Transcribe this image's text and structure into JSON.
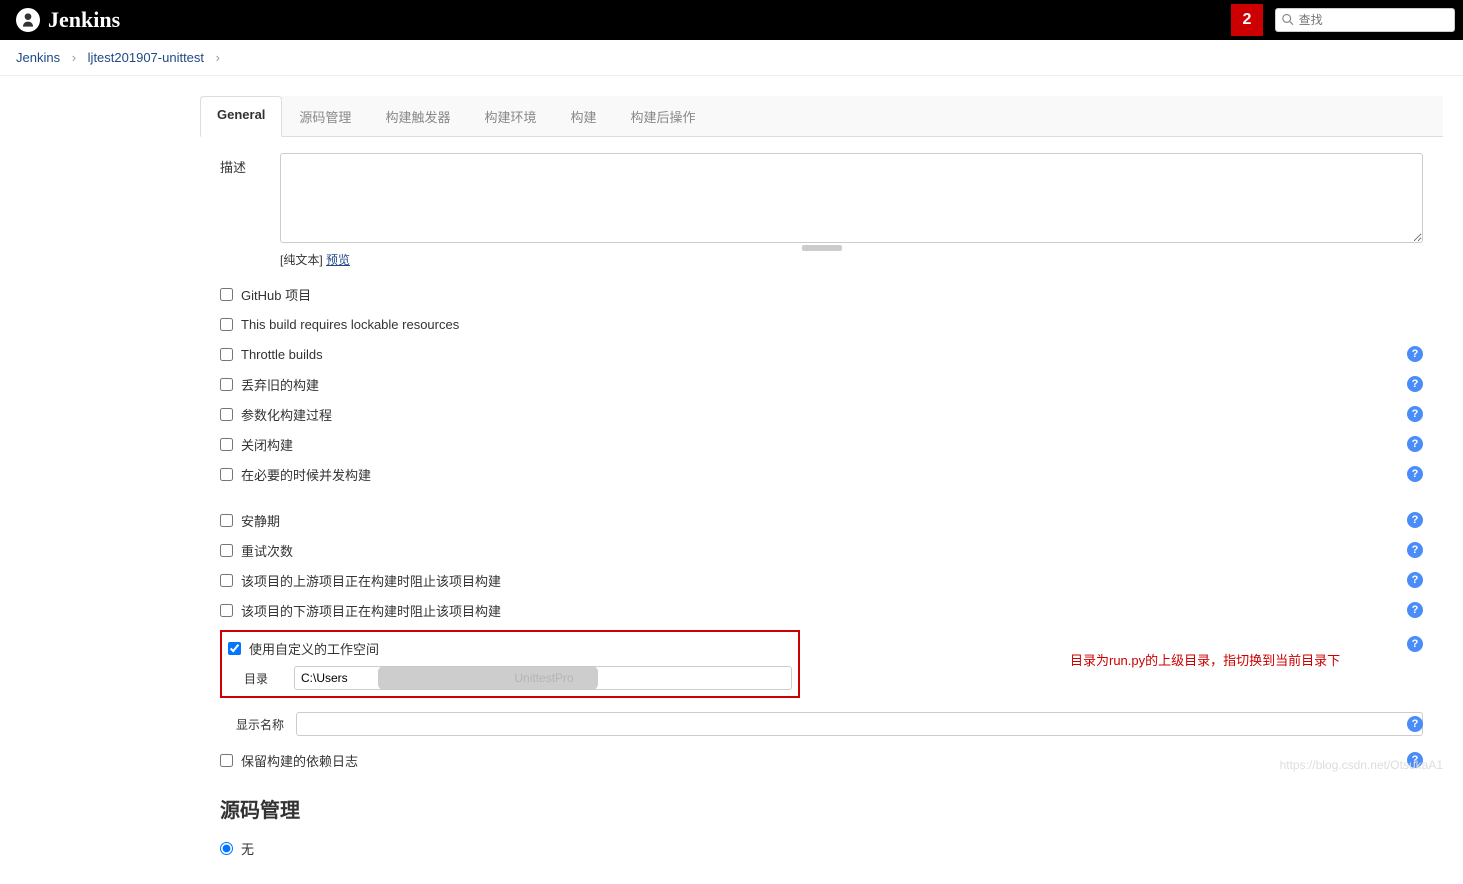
{
  "header": {
    "brand": "Jenkins",
    "notification_count": "2",
    "search_placeholder": "查找"
  },
  "breadcrumb": {
    "items": [
      "Jenkins",
      "ljtest201907-unittest"
    ]
  },
  "tabs": {
    "items": [
      "General",
      "源码管理",
      "构建触发器",
      "构建环境",
      "构建",
      "构建后操作"
    ],
    "active": 0
  },
  "general": {
    "description_label": "描述",
    "description_value": "",
    "plaintext_label": "[纯文本]",
    "preview_link": "预览",
    "checkboxes": [
      {
        "label": "GitHub 项目",
        "checked": false,
        "help": false
      },
      {
        "label": "This build requires lockable resources",
        "checked": false,
        "help": false
      },
      {
        "label": "Throttle builds",
        "checked": false,
        "help": true
      },
      {
        "label": "丢弃旧的构建",
        "checked": false,
        "help": true
      },
      {
        "label": "参数化构建过程",
        "checked": false,
        "help": true
      },
      {
        "label": "关闭构建",
        "checked": false,
        "help": true
      },
      {
        "label": "在必要的时候并发构建",
        "checked": false,
        "help": true
      }
    ],
    "checkboxes2": [
      {
        "label": "安静期",
        "checked": false,
        "help": true
      },
      {
        "label": "重试次数",
        "checked": false,
        "help": true
      },
      {
        "label": "该项目的上游项目正在构建时阻止该项目构建",
        "checked": false,
        "help": true
      },
      {
        "label": "该项目的下游项目正在构建时阻止该项目构建",
        "checked": false,
        "help": true
      }
    ],
    "custom_workspace": {
      "label": "使用自定义的工作空间",
      "checked": true,
      "dir_label": "目录",
      "dir_value": "C:\\Users                                                  UnittestPro",
      "help": true
    },
    "annotation": "目录为run.py的上级目录，指切换到当前目录下",
    "display_name_label": "显示名称",
    "display_name_value": "",
    "keep_deps": {
      "label": "保留构建的依赖日志",
      "checked": false,
      "help": true
    }
  },
  "scm": {
    "title": "源码管理",
    "none_label": "无"
  },
  "watermark": "https://blog.csdn.net/OtsukaA1"
}
